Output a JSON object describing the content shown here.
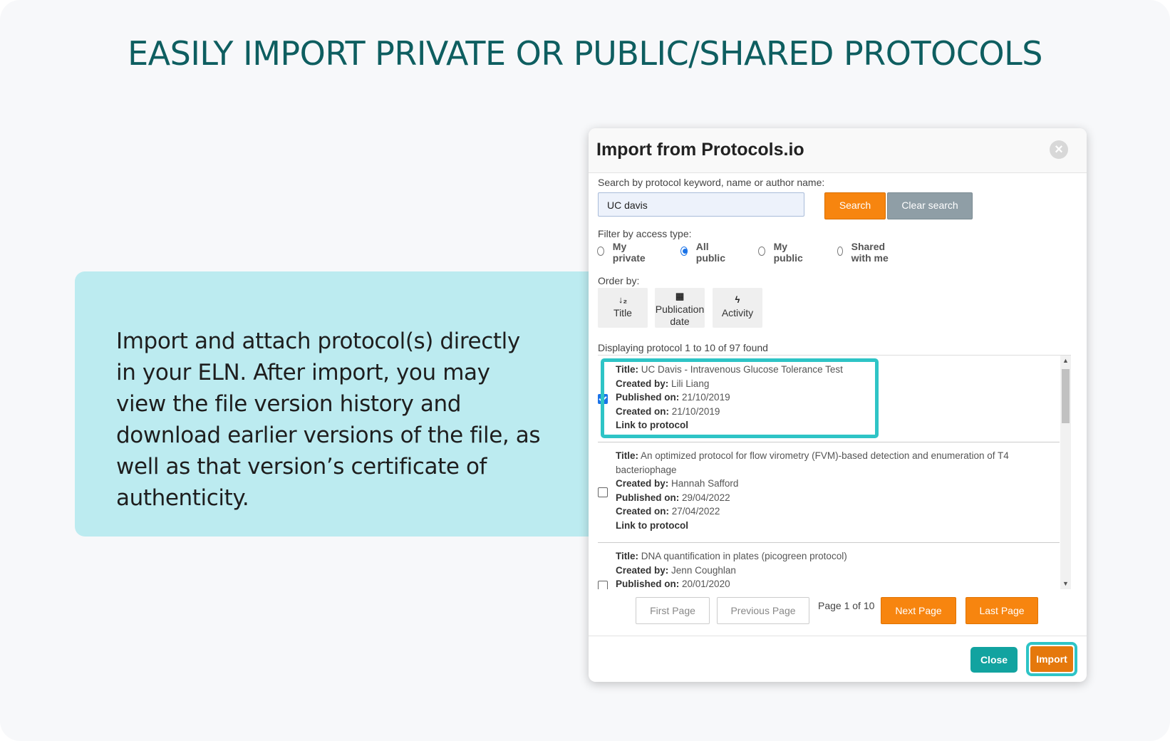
{
  "headline": "EASILY IMPORT PRIVATE OR PUBLIC/SHARED PROTOCOLS",
  "info": {
    "text": "Import and attach protocol(s) directly in your ELN. After import, you may view the file version history and download earlier versions of the file, as well as that version’s certificate of authenticity."
  },
  "dialog": {
    "title": "Import from Protocols.io",
    "close_icon": "×",
    "search": {
      "label": "Search by protocol keyword, name or author name:",
      "value": "UC davis",
      "search_label": "Search",
      "clear_label": "Clear search"
    },
    "filter": {
      "label": "Filter by access type:",
      "options": [
        {
          "label": "My private",
          "selected": false
        },
        {
          "label": "All public",
          "selected": true
        },
        {
          "label": "My public",
          "selected": false
        },
        {
          "label": "Shared with me",
          "selected": false
        }
      ]
    },
    "order": {
      "label": "Order by:",
      "options": [
        {
          "icon": "sort-icon",
          "glyph": "↓₂",
          "label": "Title"
        },
        {
          "icon": "calendar-icon",
          "glyph": "▦",
          "label": "Publication date"
        },
        {
          "icon": "bolt-icon",
          "glyph": "ϟ",
          "label": "Activity"
        }
      ]
    },
    "results_summary": "Displaying protocol 1 to 10 of 97 found",
    "field_labels": {
      "title": "Title:",
      "created_by": "Created by:",
      "published_on": "Published on:",
      "created_on": "Created on:",
      "link": "Link to protocol"
    },
    "protocols": [
      {
        "title": "UC Davis - Intravenous Glucose Tolerance Test",
        "created_by": "Lili Liang",
        "published_on": "21/10/2019",
        "created_on": "21/10/2019",
        "checked": true
      },
      {
        "title": "An optimized protocol for flow virometry (FVM)-based detection and enumeration of T4 bacteriophage",
        "created_by": "Hannah Safford",
        "published_on": "29/04/2022",
        "created_on": "27/04/2022",
        "checked": false
      },
      {
        "title": "DNA quantification in plates (picogreen protocol)",
        "created_by": "Jenn Coughlan",
        "published_on": "20/01/2020",
        "checked": false
      }
    ],
    "pagination": {
      "first": "First Page",
      "previous": "Previous Page",
      "status": "Page 1 of 10",
      "next": "Next Page",
      "last": "Last Page"
    },
    "footer": {
      "close_label": "Close",
      "import_label": "Import"
    }
  },
  "colors": {
    "headline": "#0e5e60",
    "info_card": "#bcebf0",
    "accent_orange": "#f7850f",
    "highlight_teal": "#2ec4c6",
    "close_teal": "#12a3a0"
  }
}
